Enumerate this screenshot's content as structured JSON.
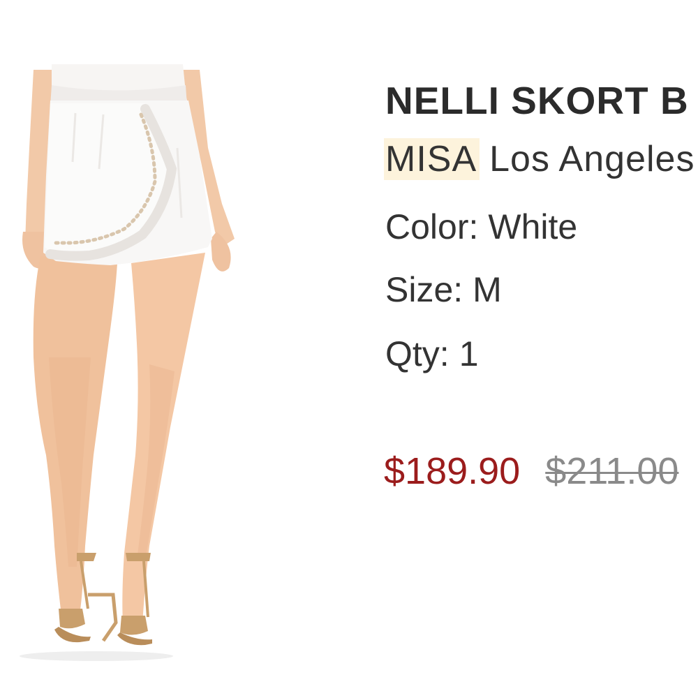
{
  "product": {
    "title": "NELLI SKORT B",
    "brand_highlight": "MISA",
    "brand_rest": "Los Angeles",
    "color_label": "Color:",
    "color_value": "White",
    "size_label": "Size:",
    "size_value": "M",
    "qty_label": "Qty:",
    "qty_value": "1",
    "sale_price": "$189.90",
    "original_price": "$211.00",
    "image": "white ruffled eyelet skort worn by model with tan strappy heels"
  },
  "colors": {
    "sale_price": "#9b1c1c",
    "original_price": "#8a8a8a",
    "brand_highlight_bg": "#fdf3dc",
    "text": "#333333"
  }
}
